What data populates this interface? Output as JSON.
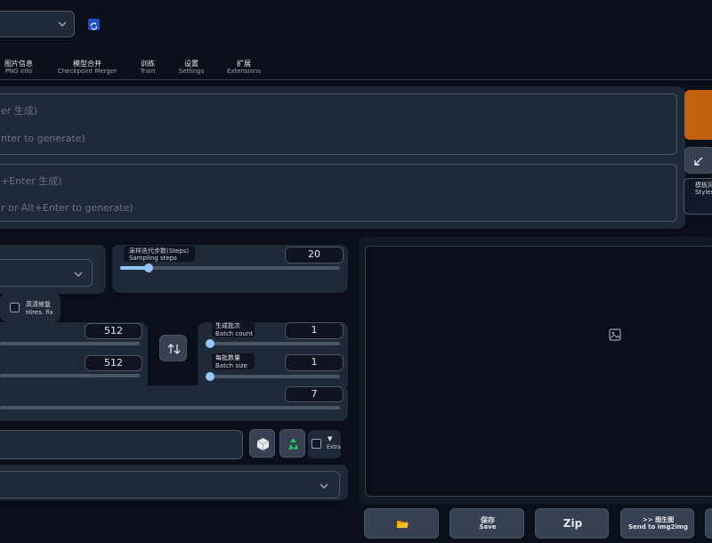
{
  "top": {
    "checkpoint_dropdown_value": "",
    "refresh_icon": "refresh-icon"
  },
  "tabs": [
    {
      "zh": "图片信息",
      "en": "PNG Info"
    },
    {
      "zh": "模型合并",
      "en": "Checkpoint Merger"
    },
    {
      "zh": "训练",
      "en": "Train"
    },
    {
      "zh": "设置",
      "en": "Settings"
    },
    {
      "zh": "扩展",
      "en": "Extensions"
    }
  ],
  "prompt": {
    "line1": "er 生成)",
    "line2": "nter to generate)"
  },
  "negative_prompt": {
    "line1": "+Enter 生成)",
    "line2": "r or Alt+Enter to generate)"
  },
  "right_controls": {
    "generate_color": "#c2620e",
    "arrow_icon": "diagonal-arrow-icon",
    "styles_zh": "模板风",
    "styles_en": "Styles"
  },
  "sampling": {
    "steps_zh": "采样迭代步数(Steps)",
    "steps_en": "Sampling steps",
    "steps_value": "20",
    "steps_fraction": 0.13
  },
  "hires": {
    "zh": "高清修复",
    "en": "Hires. fix"
  },
  "size": {
    "width_value": "512",
    "height_value": "512",
    "swap_icon": "swap-vertical-icon"
  },
  "batch": {
    "count_zh": "生成批次",
    "count_en": "Batch count",
    "count_value": "1",
    "size_zh": "每批数量",
    "size_en": "Batch size",
    "size_value": "1"
  },
  "cfg": {
    "value": "7"
  },
  "seed": {
    "dice_icon": "dice-icon",
    "recycle_icon": "recycle-icon",
    "extra_label": "Extra",
    "extra_arrow": "▼"
  },
  "output": {
    "image_icon": "image-placeholder-icon"
  },
  "bottom_buttons": {
    "folder_icon": "folder-icon",
    "save_zh": "保存",
    "save_en": "Save",
    "zip": "Zip",
    "send_zh": ">> 图生图",
    "send_en": "Send to img2img"
  }
}
